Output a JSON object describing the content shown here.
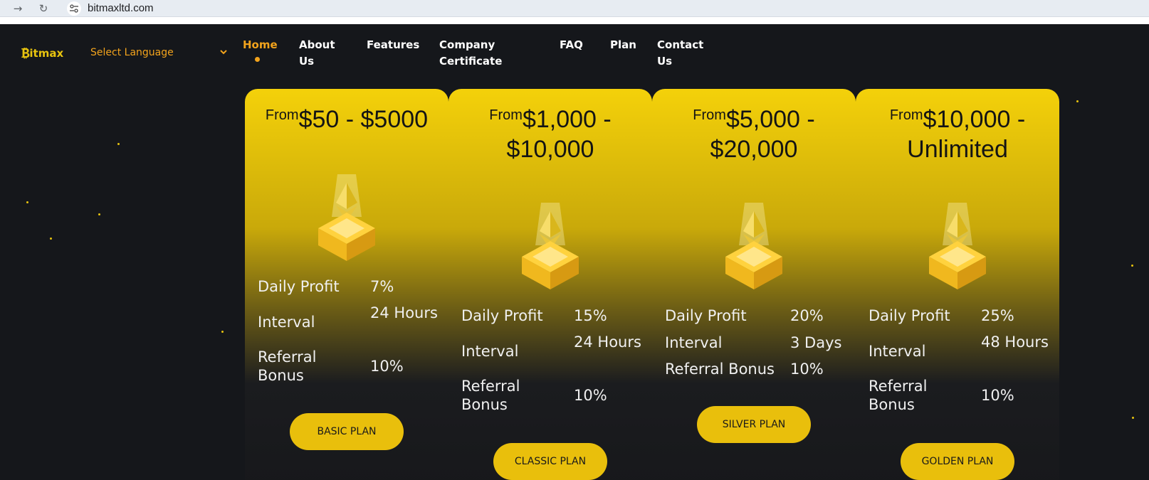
{
  "browser": {
    "url": "bitmaxltd.com"
  },
  "header": {
    "logo_b": "₿",
    "logo_text": "itmax",
    "language_label": "Select Language",
    "nav": [
      {
        "label": "Home",
        "active": true
      },
      {
        "label": "About Us"
      },
      {
        "label": "Features"
      },
      {
        "label": "Company Certificate"
      },
      {
        "label": "FAQ"
      },
      {
        "label": "Plan"
      },
      {
        "label": "Contact Us"
      }
    ]
  },
  "colors": {
    "accent": "#f2a31c",
    "card_gold": "#f4d10a",
    "button": "#e9bf0c",
    "background": "#15171b"
  },
  "plans": [
    {
      "from": "From",
      "range": "$50 - $5000",
      "daily_profit_label": "Daily Profit",
      "daily_profit": "7%",
      "interval_label": "Interval",
      "interval": "24 Hours",
      "referral_label": "Referral Bonus",
      "referral": "10%",
      "button": "BASIC PLAN"
    },
    {
      "from": "From",
      "range": "$1,000 - $10,000",
      "daily_profit_label": "Daily Profit",
      "daily_profit": "15%",
      "interval_label": "Interval",
      "interval": "24 Hours",
      "referral_label": "Referral Bonus",
      "referral": "10%",
      "button": "CLASSIC PLAN"
    },
    {
      "from": "From",
      "range": "$5,000 - $20,000",
      "daily_profit_label": "Daily Profit",
      "daily_profit": "20%",
      "interval_label": "Interval",
      "interval": "3 Days",
      "referral_label": "Referral Bonus",
      "referral": "10%",
      "button": "SILVER PLAN"
    },
    {
      "from": "From",
      "range": "$10,000 - Unlimited",
      "daily_profit_label": "Daily Profit",
      "daily_profit": "25%",
      "interval_label": "Interval",
      "interval": "48 Hours",
      "referral_label": "Referral Bonus",
      "referral": "10%",
      "button": "GOLDEN PLAN"
    }
  ]
}
